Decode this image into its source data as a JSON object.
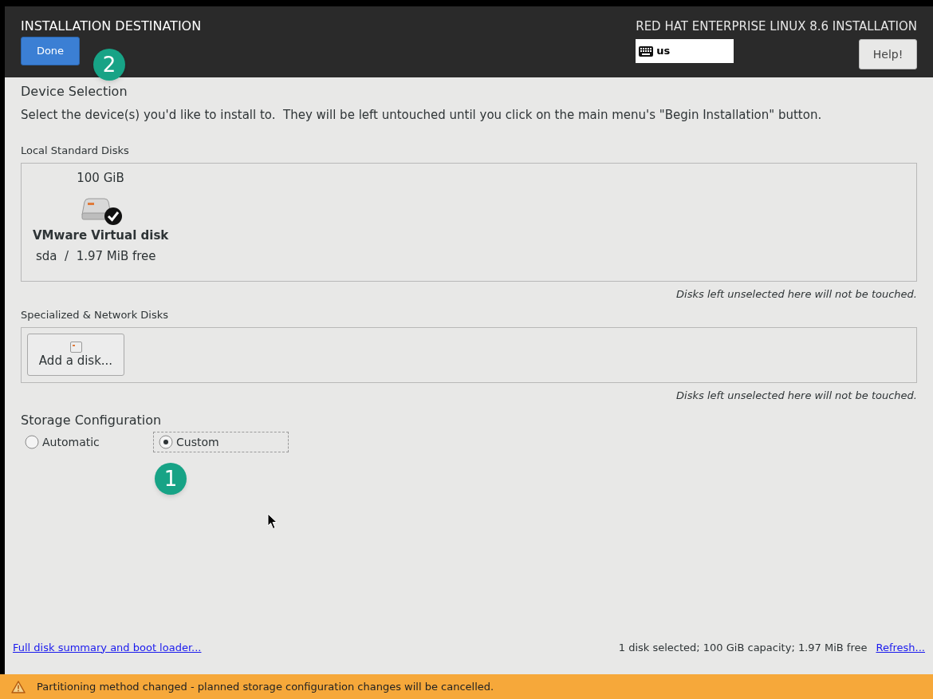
{
  "header": {
    "title": "INSTALLATION DESTINATION",
    "done_button": "Done",
    "callout": "2",
    "product": "RED HAT ENTERPRISE LINUX 8.6 INSTALLATION",
    "keyboard_layout": "us",
    "help_button": "Help!"
  },
  "device_selection": {
    "title": "Device Selection",
    "description": "Select the device(s) you'd like to install to.  They will be left untouched until you click on the main menu's \"Begin Installation\" button."
  },
  "local_disks": {
    "title": "Local Standard Disks",
    "disks": [
      {
        "size": "100 GiB",
        "name": "VMware Virtual disk",
        "details": "sda  /  1.97 MiB free",
        "selected": true
      }
    ],
    "note": "Disks left unselected here will not be touched."
  },
  "specialized_disks": {
    "title": "Specialized & Network Disks",
    "add_button": "Add a disk...",
    "note": "Disks left unselected here will not be touched."
  },
  "storage_configuration": {
    "title": "Storage Configuration",
    "options": [
      {
        "label": "Automatic",
        "selected": false
      },
      {
        "label": "Custom",
        "selected": true
      }
    ],
    "callout": "1"
  },
  "footer": {
    "summary_link": "Full disk summary and boot loader...",
    "status": "1 disk selected; 100 GiB capacity; 1.97 MiB free",
    "refresh_link": "Refresh..."
  },
  "warning": {
    "message": "Partitioning method changed - planned storage configuration changes will be cancelled."
  }
}
